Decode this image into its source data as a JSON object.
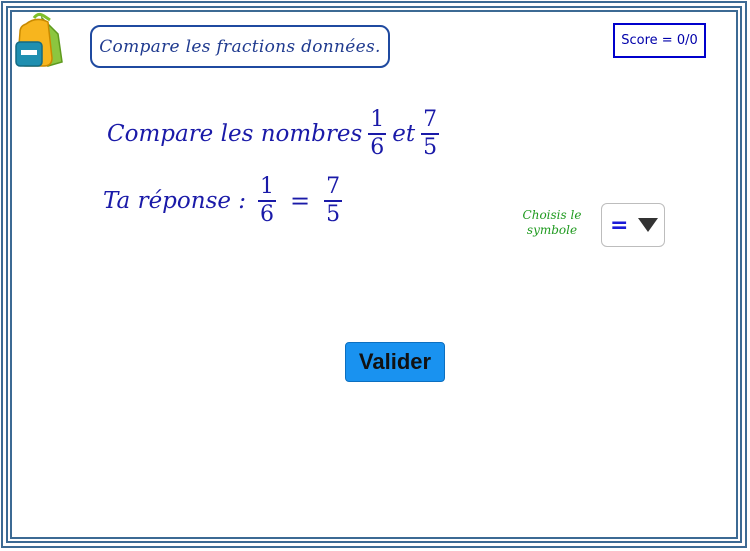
{
  "instruction": {
    "text": "Compare les fractions données."
  },
  "score": {
    "label": "Score = 0/0"
  },
  "question": {
    "prefix": "Compare les nombres",
    "fraction_a": {
      "numerator": "1",
      "denominator": "6"
    },
    "connector": "et",
    "fraction_b": {
      "numerator": "7",
      "denominator": "5"
    }
  },
  "answer": {
    "prefix": "Ta réponse :",
    "fraction_a": {
      "numerator": "1",
      "denominator": "6"
    },
    "symbol": "=",
    "fraction_b": {
      "numerator": "7",
      "denominator": "5"
    }
  },
  "symbol_picker": {
    "hint": "Choisis le symbole",
    "selected": "="
  },
  "validate_button": {
    "label": "Valider"
  },
  "colors": {
    "border": "#3c6a94",
    "math_text": "#1a1aa8",
    "hint_text": "#1f9a1f",
    "button_bg": "#1992f0",
    "score_border": "#0000cc"
  },
  "icons": {
    "logo": "backpack-icon",
    "dropdown": "caret-down-icon"
  }
}
